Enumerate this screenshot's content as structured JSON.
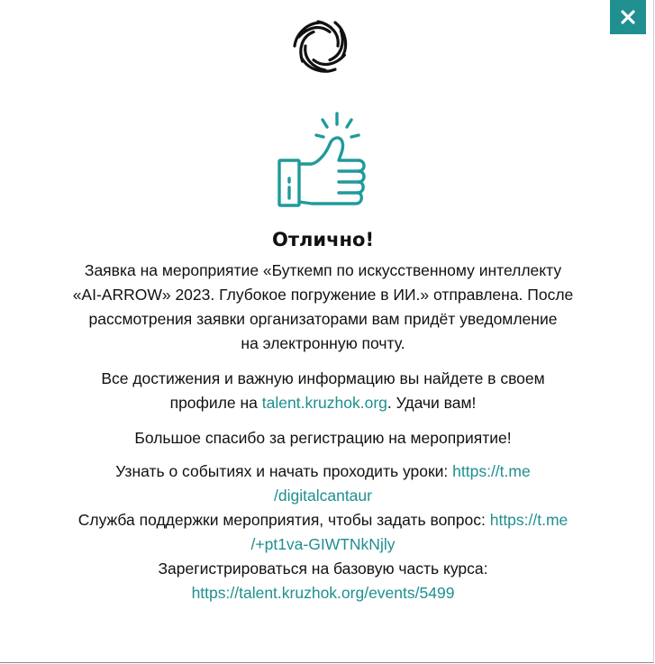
{
  "modal": {
    "close_icon": "close-icon",
    "logo_icon": "circular-logo-icon",
    "success_icon": "thumbs-up-icon",
    "accent_color": "#1f8f8f",
    "title": "Отлично!",
    "application": {
      "lines": [
        "Заявка на мероприятие «Буткемп по искусственному интеллекту",
        "«AI-ARROW» 2023. Глубокое погружение в ИИ.» отправлена. После",
        "рассмотрения заявки организаторами вам придёт уведомление",
        "на электронную почту."
      ]
    },
    "achievements": {
      "line1": "Все достижения и важную информацию вы найдете в своем",
      "line2_prefix": "профиле на ",
      "link": "talent.kruzhok.org",
      "line2_suffix": ". Удачи вам!"
    },
    "thanks": "Большое спасибо за регистрацию на мероприятие!",
    "events": {
      "prefix": "Узнать о событиях и начать проходить уроки: ",
      "link_part1": "https://t.me",
      "link_part2": "/digitalcantaur"
    },
    "support": {
      "prefix": "Служба поддержки мероприятия, чтобы задать вопрос: ",
      "link_part1": "https://t.me",
      "link_part2": "/+pt1va-GIWTNkNjly"
    },
    "register": {
      "label": "Зарегистрироваться на базовую часть курса:",
      "link": "https://talent.kruzhok.org/events/5499"
    }
  }
}
